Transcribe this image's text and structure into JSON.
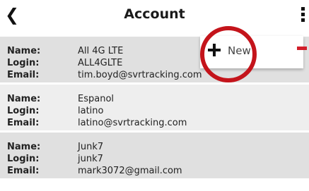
{
  "header": {
    "title": "Account"
  },
  "popup": {
    "new_label": "New"
  },
  "accounts": [
    {
      "name_label": "Name:",
      "login_label": "Login:",
      "email_label": "Email:",
      "name": "All 4G LTE",
      "login": "ALL4GLTE",
      "email": "tim.boyd@svrtracking.com"
    },
    {
      "name_label": "Name:",
      "login_label": "Login:",
      "email_label": "Email:",
      "name": "Espanol",
      "login": "latino",
      "email": "latino@svrtracking.com"
    },
    {
      "name_label": "Name:",
      "login_label": "Login:",
      "email_label": "Email:",
      "name": "Junk7",
      "login": "junk7",
      "email": "mark3072@gmail.com"
    }
  ],
  "colors": {
    "highlight_ring": "#c4141b",
    "accent_red": "#d11e2a"
  },
  "icons": {
    "back": "back-chevron-icon",
    "menu": "kebab-menu-icon",
    "new": "plus-icon"
  }
}
